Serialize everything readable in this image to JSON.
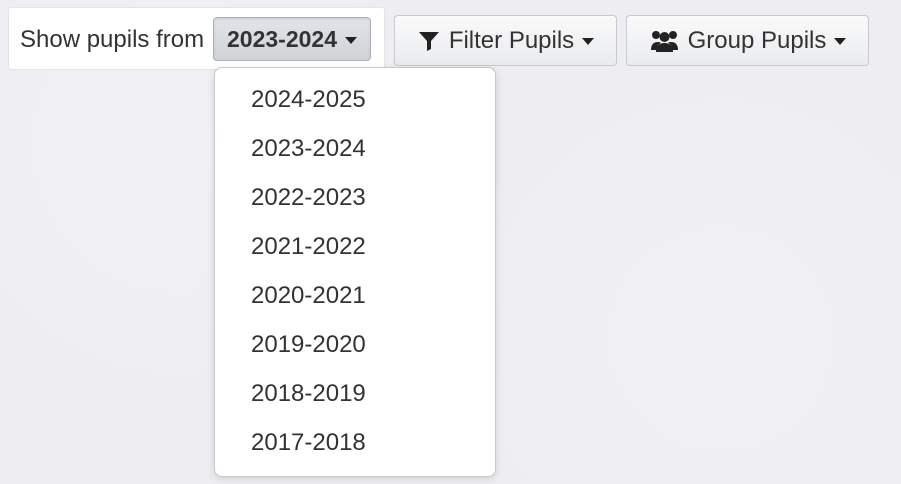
{
  "toolbar": {
    "show_label": "Show pupils from",
    "selected_year": "2023-2024",
    "filter_label": "Filter Pupils",
    "group_label": "Group Pupils"
  },
  "dropdown": {
    "items": [
      "2024-2025",
      "2023-2024",
      "2022-2023",
      "2021-2022",
      "2020-2021",
      "2019-2020",
      "2018-2019",
      "2017-2018"
    ]
  },
  "icons": {
    "filter": "filter-icon",
    "group": "users-icon",
    "caret": "caret-down-icon"
  },
  "colors": {
    "background": "#ededf2",
    "text": "#333333",
    "selected_button": "#d8dbe0"
  }
}
